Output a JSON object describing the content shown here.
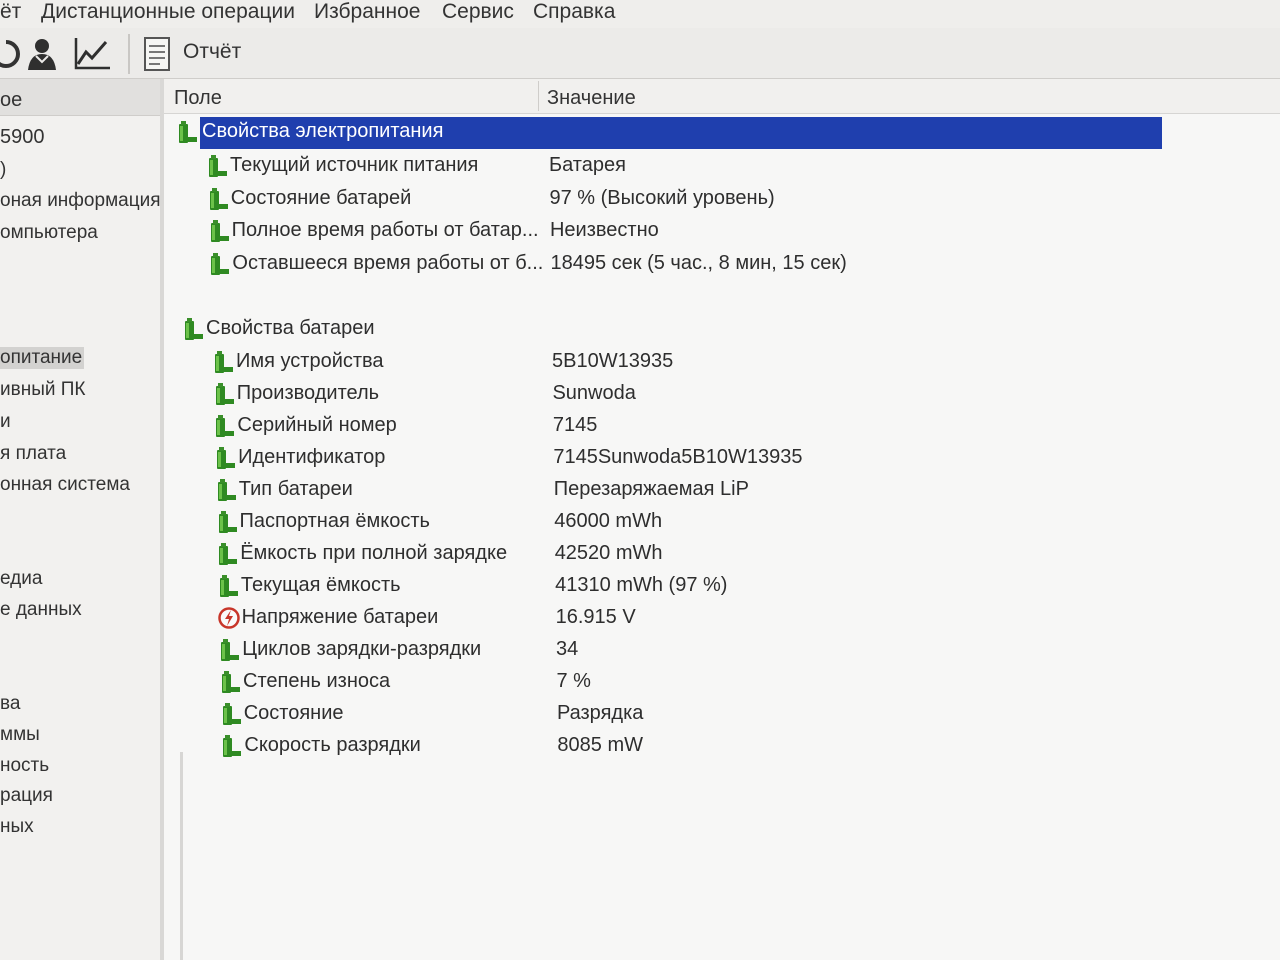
{
  "menu": {
    "items": [
      "ёт",
      "Дистанционные операции",
      "Избранное",
      "Сервис",
      "Справка"
    ]
  },
  "toolbar": {
    "icons": [
      "refresh-icon",
      "user-icon",
      "chart-icon",
      "report-icon"
    ],
    "report_label": "Отчёт"
  },
  "leftpane": {
    "header": "ое",
    "items": [
      "5900",
      ")",
      "оная информация",
      "омпьютера",
      "опитание",
      "ивный ПК",
      "и",
      "я плата",
      "онная система",
      "едиа",
      "е данных",
      "ва",
      "ммы",
      "ность",
      "рация",
      "ных"
    ],
    "selected_index": 4
  },
  "columns": {
    "field": "Поле",
    "value": "Значение"
  },
  "power_section": {
    "title": "Свойства электропитания",
    "rows": [
      {
        "label": "Текущий источник питания",
        "value": "Батарея",
        "icon": "battery-icon"
      },
      {
        "label": "Состояние батарей",
        "value": "97 % (Высокий уровень)",
        "icon": "battery-icon"
      },
      {
        "label": "Полное время работы от батар...",
        "value": "Неизвестно",
        "icon": "battery-icon"
      },
      {
        "label": "Оставшееся время работы от б...",
        "value": "18495 сек (5 час., 8 мин, 15 сек)",
        "icon": "battery-icon"
      }
    ]
  },
  "battery_section": {
    "title": "Свойства батареи",
    "rows": [
      {
        "label": "Имя устройства",
        "value": "5B10W13935",
        "icon": "battery-icon"
      },
      {
        "label": "Производитель",
        "value": "Sunwoda",
        "icon": "battery-icon"
      },
      {
        "label": "Серийный номер",
        "value": "7145",
        "icon": "battery-icon"
      },
      {
        "label": "Идентификатор",
        "value": "7145Sunwoda5B10W13935",
        "icon": "battery-icon"
      },
      {
        "label": "Тип батареи",
        "value": "Перезаряжаемая LiP",
        "icon": "battery-icon"
      },
      {
        "label": "Паспортная ёмкость",
        "value": "46000 mWh",
        "icon": "battery-icon"
      },
      {
        "label": "Ёмкость при полной зарядке",
        "value": "42520 mWh",
        "icon": "battery-icon"
      },
      {
        "label": "Текущая ёмкость",
        "value": "41310 mWh  (97 %)",
        "icon": "battery-icon"
      },
      {
        "label": "Напряжение батареи",
        "value": "16.915 V",
        "icon": "voltage-icon"
      },
      {
        "label": "Циклов зарядки-разрядки",
        "value": "34",
        "icon": "battery-icon"
      },
      {
        "label": "Степень износа",
        "value": "7 %",
        "icon": "battery-icon"
      },
      {
        "label": "Состояние",
        "value": "Разрядка",
        "icon": "battery-icon"
      },
      {
        "label": "Скорость разрядки",
        "value": "8085 mW",
        "icon": "battery-icon"
      }
    ]
  },
  "colors": {
    "selection": "#1f3fae",
    "battery_green": "#2f8a22",
    "voltage_red": "#c8362a"
  }
}
